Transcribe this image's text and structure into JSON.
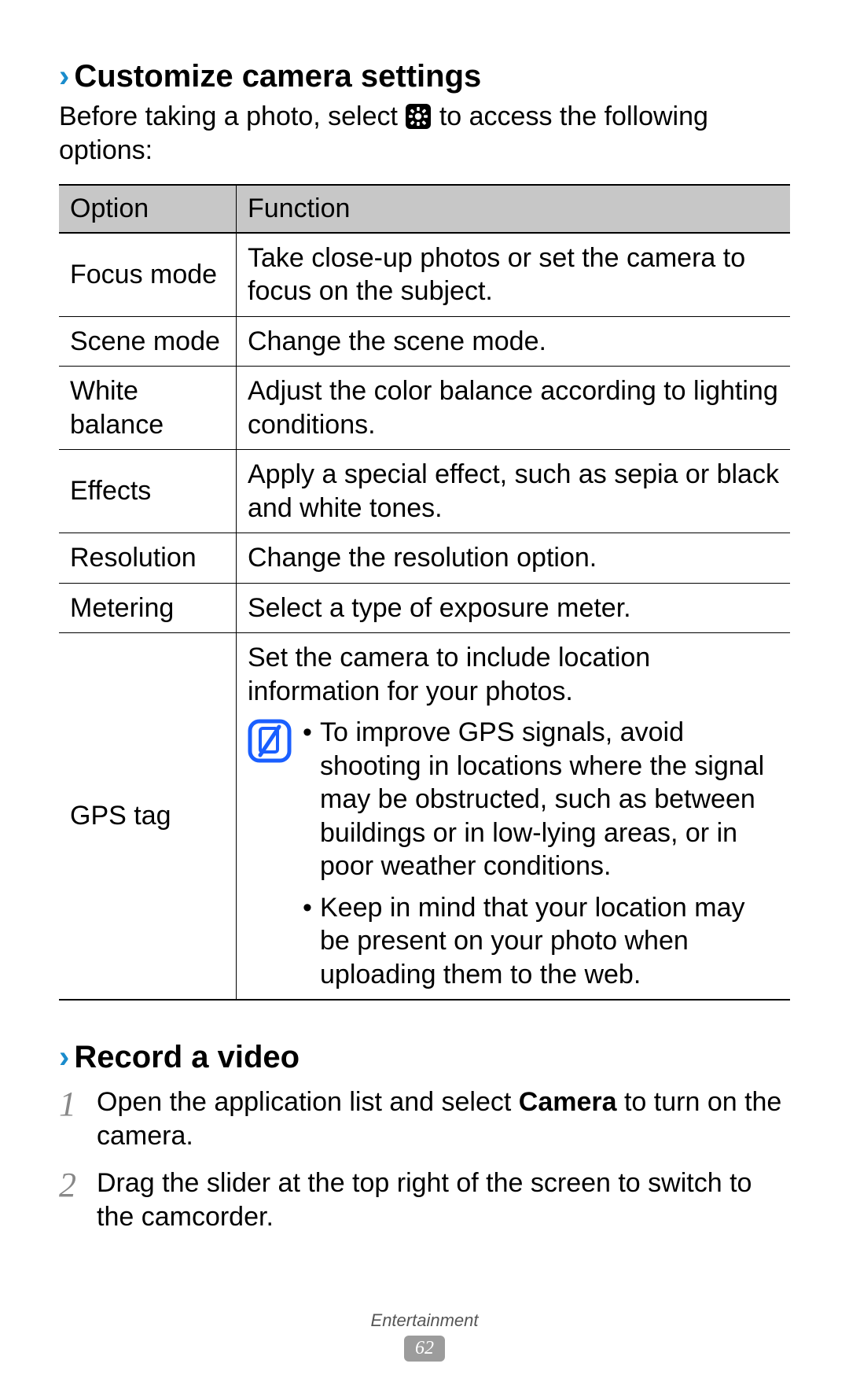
{
  "section1": {
    "heading": "Customize camera settings",
    "intro_before": "Before taking a photo, select ",
    "intro_after": " to access the following options:",
    "gear_icon_name": "gear-icon"
  },
  "table": {
    "col_option": "Option",
    "col_function": "Function",
    "rows": [
      {
        "option": "Focus mode",
        "function": "Take close-up photos or set the camera to focus on the subject."
      },
      {
        "option": "Scene mode",
        "function": "Change the scene mode."
      },
      {
        "option": "White balance",
        "function": "Adjust the color balance according to lighting conditions."
      },
      {
        "option": "Effects",
        "function": "Apply a special effect, such as sepia or black and white tones."
      },
      {
        "option": "Resolution",
        "function": "Change the resolution option."
      },
      {
        "option": "Metering",
        "function": "Select a type of exposure meter."
      }
    ],
    "gps": {
      "option": "GPS tag",
      "main": "Set the camera to include location information for your photos.",
      "notes": [
        "To improve GPS signals, avoid shooting in locations where the signal may be obstructed, such as between buildings or in low-lying areas, or in poor weather conditions.",
        "Keep in mind that your location may be present on your photo when uploading them to the web."
      ]
    }
  },
  "section2": {
    "heading": "Record a video",
    "steps": [
      {
        "num": "1",
        "before": "Open the application list and select ",
        "bold": "Camera",
        "after": " to turn on the camera."
      },
      {
        "num": "2",
        "before": "Drag the slider at the top right of the screen to switch to the camcorder.",
        "bold": "",
        "after": ""
      }
    ]
  },
  "footer": {
    "category": "Entertainment",
    "page": "62"
  }
}
